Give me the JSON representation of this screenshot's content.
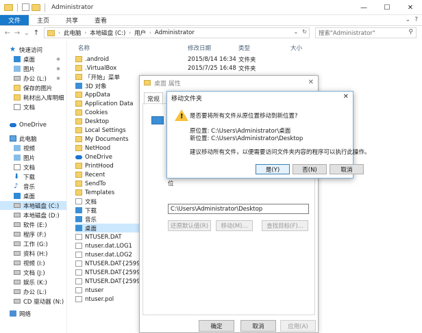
{
  "window": {
    "title": "Administrator",
    "controls": {
      "minimize": "—",
      "maximize": "☐",
      "close": "✕"
    }
  },
  "ribbon": {
    "tabs": [
      "文件",
      "主页",
      "共享",
      "查看"
    ],
    "right": {
      "collapse": "⌄",
      "help": "?"
    }
  },
  "address": {
    "back": "←",
    "forward": "→",
    "recent": "⌄",
    "up": "↑",
    "crumbs": [
      "此电脑",
      "本地磁盘 (C:)",
      "用户",
      "Administrator"
    ],
    "chevron": "›",
    "dropdown": "⌄",
    "refresh": "↻"
  },
  "search": {
    "placeholder": "搜索\"Administrator\"",
    "icon": "⚲"
  },
  "nav": {
    "quick_access": "快速访问",
    "pinned": [
      {
        "label": "桌面",
        "icon": "desktop-icon"
      },
      {
        "label": "图片",
        "icon": "pictures-icon"
      },
      {
        "label": "办公 (L:)",
        "icon": "drive-icon"
      },
      {
        "label": "保存的图片",
        "icon": "folder-icon"
      },
      {
        "label": "耗材出入库明细",
        "icon": "folder-icon"
      },
      {
        "label": "文档",
        "icon": "documents-icon"
      }
    ],
    "pin_glyph": "✱",
    "onedrive": "OneDrive",
    "this_pc": "此电脑",
    "pc_items": [
      {
        "label": "视频",
        "icon": "videos-icon"
      },
      {
        "label": "图片",
        "icon": "pictures-icon"
      },
      {
        "label": "文档",
        "icon": "documents-icon"
      },
      {
        "label": "下载",
        "icon": "downloads-icon"
      },
      {
        "label": "音乐",
        "icon": "music-icon"
      },
      {
        "label": "桌面",
        "icon": "desktop-icon"
      },
      {
        "label": "本地磁盘 (C:)",
        "icon": "drive-icon"
      },
      {
        "label": "本地磁盘 (D:)",
        "icon": "drive-icon"
      },
      {
        "label": "软件 (E:)",
        "icon": "drive-icon"
      },
      {
        "label": "程序 (F:)",
        "icon": "drive-icon"
      },
      {
        "label": "工作 (G:)",
        "icon": "drive-icon"
      },
      {
        "label": "资料 (H:)",
        "icon": "drive-icon"
      },
      {
        "label": "视频 (I:)",
        "icon": "drive-icon"
      },
      {
        "label": "文档 (J:)",
        "icon": "drive-icon"
      },
      {
        "label": "娱乐 (K:)",
        "icon": "drive-icon"
      },
      {
        "label": "办公 (L:)",
        "icon": "drive-icon"
      },
      {
        "label": "CD 驱动器 (N:)",
        "icon": "cd-drive-icon"
      }
    ],
    "network": "网络"
  },
  "columns": {
    "name": "名称",
    "date": "修改日期",
    "type": "类型",
    "size": "大小"
  },
  "files": [
    {
      "name": ".android",
      "date": "2015/8/14 16:34",
      "type": "文件夹",
      "icon": "folder"
    },
    {
      "name": ".VirtualBox",
      "date": "2015/7/25 16:48",
      "type": "文件夹",
      "icon": "folder"
    },
    {
      "name": "「开始」菜单",
      "date": "",
      "type": "",
      "icon": "link"
    },
    {
      "name": "3D 对象",
      "date": "",
      "type": "",
      "icon": "blue"
    },
    {
      "name": "AppData",
      "date": "",
      "type": "",
      "icon": "folder"
    },
    {
      "name": "Application Data",
      "date": "",
      "type": "",
      "icon": "link"
    },
    {
      "name": "Cookies",
      "date": "",
      "type": "",
      "icon": "link"
    },
    {
      "name": "Desktop",
      "date": "",
      "type": "",
      "icon": "folder"
    },
    {
      "name": "Local Settings",
      "date": "",
      "type": "",
      "icon": "link"
    },
    {
      "name": "My Documents",
      "date": "",
      "type": "",
      "icon": "link"
    },
    {
      "name": "NetHood",
      "date": "",
      "type": "",
      "icon": "link"
    },
    {
      "name": "OneDrive",
      "date": "",
      "type": "",
      "icon": "cloud"
    },
    {
      "name": "PrintHood",
      "date": "",
      "type": "",
      "icon": "link"
    },
    {
      "name": "Recent",
      "date": "",
      "type": "",
      "icon": "link"
    },
    {
      "name": "SendTo",
      "date": "",
      "type": "",
      "icon": "link"
    },
    {
      "name": "Templates",
      "date": "",
      "type": "",
      "icon": "link"
    },
    {
      "name": "文档",
      "date": "",
      "type": "",
      "icon": "doc"
    },
    {
      "name": "下载",
      "date": "",
      "type": "",
      "icon": "blue"
    },
    {
      "name": "音乐",
      "date": "",
      "type": "",
      "icon": "blue"
    },
    {
      "name": "桌面",
      "date": "",
      "type": "",
      "icon": "blue",
      "selected": true
    },
    {
      "name": "NTUSER.DAT",
      "date": "",
      "type": "",
      "icon": "doc"
    },
    {
      "name": "ntuser.dat.LOG1",
      "date": "",
      "type": "",
      "icon": "doc"
    },
    {
      "name": "ntuser.dat.LOG2",
      "date": "",
      "type": "",
      "icon": "doc"
    },
    {
      "name": "NTUSER.DAT{2599cde",
      "date": "",
      "type": "",
      "icon": "doc"
    },
    {
      "name": "NTUSER.DAT{2599cde",
      "date": "",
      "type": "",
      "icon": "doc"
    },
    {
      "name": "NTUSER.DAT{2599cde",
      "date": "",
      "type": "",
      "icon": "doc"
    },
    {
      "name": "ntuser",
      "date": "",
      "type": "",
      "icon": "doc"
    },
    {
      "name": "ntuser.pol",
      "date": "",
      "type": "",
      "icon": "doc"
    }
  ],
  "props": {
    "title": "桌面 属性",
    "close": "✕",
    "tab": "常规",
    "folder_text": "文",
    "desc1": "位",
    "desc2": "位",
    "path": "C:\\Users\\Administrator\\Desktop",
    "restore": "还原默认值(R)",
    "move": "移动(M)...",
    "find": "查找目标(F)...",
    "ok": "确定",
    "cancel": "取消",
    "apply": "应用(A)"
  },
  "move_dialog": {
    "title": "移动文件夹",
    "close": "✕",
    "warn_glyph": "!",
    "question": "是否要将所有文件从原位置移动到新位置?",
    "old_location": "原位置: C:\\Users\\Administrator\\桌面",
    "new_location": "新位置: C:\\Users\\Administrator\\Desktop",
    "advice": "建议移动所有文件，以便需要访问文件夹内容的程序可以执行此操作。",
    "yes": "是(Y)",
    "no": "否(N)",
    "cancel": "取消"
  }
}
